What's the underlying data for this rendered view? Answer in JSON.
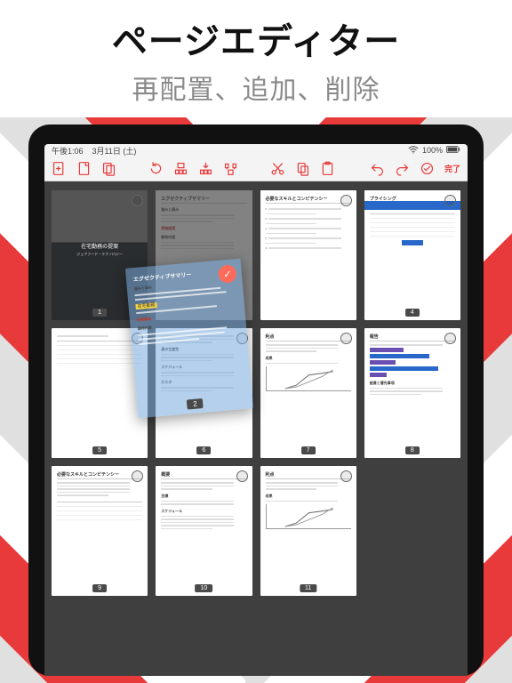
{
  "header": {
    "title": "ページエディター",
    "subtitle": "再配置、追加、削除"
  },
  "status": {
    "time": "午後1:06",
    "date": "3月11日 (土)",
    "battery": "100%"
  },
  "toolbar": {
    "add": "追加",
    "blank": "空白",
    "duplicate": "複製",
    "rotate": "回転",
    "extract": "抽出",
    "insert": "挿入",
    "merge": "マージ",
    "cut": "切り取り",
    "copy": "コピー",
    "paste": "貼り付け",
    "undo": "元に戻す",
    "redo": "やり直し",
    "select_all": "すべて選択",
    "done": "完了"
  },
  "pages": [
    {
      "n": "1",
      "kind": "cover",
      "title": "在宅勤務の提案",
      "subtitle": "ジェファード・テクノロジー"
    },
    {
      "n": "2",
      "kind": "drag-slot",
      "heading": "エグゼクティブサマリー"
    },
    {
      "n": "3",
      "kind": "bullets",
      "heading": "必要なスキルとコンピテンシー"
    },
    {
      "n": "4",
      "kind": "table-blue",
      "heading": "プライシング"
    },
    {
      "n": "5",
      "kind": "table",
      "heading": ""
    },
    {
      "n": "6",
      "kind": "text",
      "heading": "",
      "sub1": "真の生産性",
      "sub2": "スケジュール",
      "sub3": "カスタ"
    },
    {
      "n": "7",
      "kind": "linechart",
      "heading": "利点",
      "sub": "成果"
    },
    {
      "n": "8",
      "kind": "barchart",
      "heading": "報告",
      "sub": "経費と優先事項"
    },
    {
      "n": "9",
      "kind": "table2",
      "heading": "必要なスキルとコンピテンシー"
    },
    {
      "n": "10",
      "kind": "text2",
      "heading": "概要",
      "sub1": "目標",
      "sub2": "スケジュール"
    },
    {
      "n": "11",
      "kind": "linechart",
      "heading": "利点",
      "sub": "成果"
    }
  ],
  "dragged": {
    "n": "2",
    "heading": "エグゼクティブサマリー",
    "sub1": "強みと弱み",
    "highlight": "在宅勤務",
    "sub2": "実施経過",
    "sub3": "期待内容"
  }
}
